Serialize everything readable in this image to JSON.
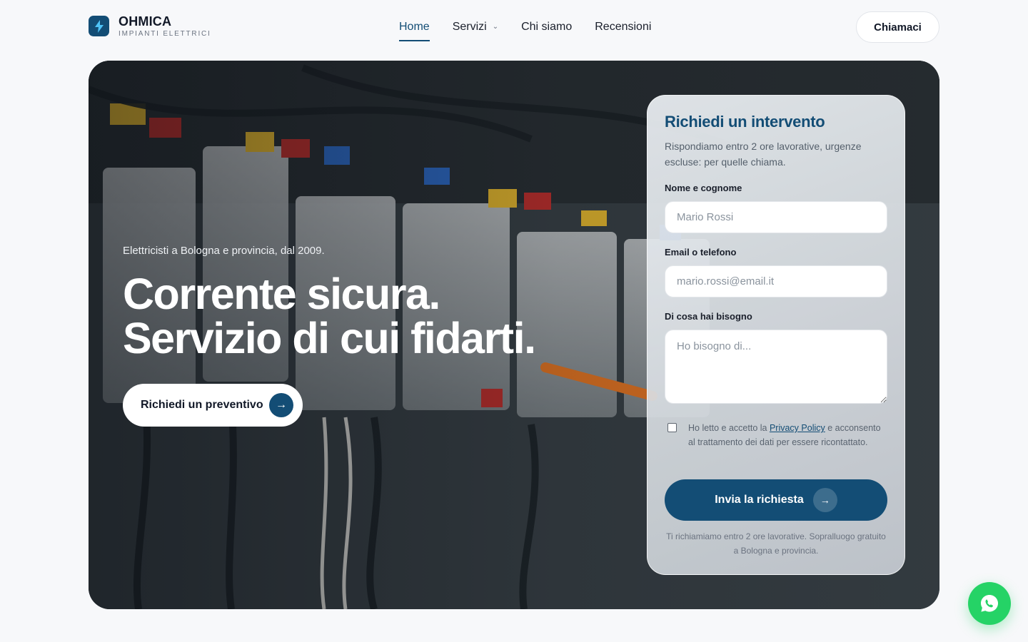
{
  "brand": {
    "name": "OHMICA",
    "tagline": "IMPIANTI ELETTRICI",
    "logo_icon": "lightning-icon",
    "accent_color": "#134d75"
  },
  "nav": {
    "items": [
      {
        "label": "Home",
        "active": true
      },
      {
        "label": "Servizi",
        "has_dropdown": true
      },
      {
        "label": "Chi siamo"
      },
      {
        "label": "Recensioni"
      }
    ],
    "call_button": "Chiamaci"
  },
  "hero": {
    "eyebrow": "Elettricisti a Bologna e provincia, dal 2009.",
    "headline_line1": "Corrente sicura.",
    "headline_line2": "Servizio di cui fidarti.",
    "cta_label": "Richiedi un preventivo",
    "cta_icon": "arrow-right-icon"
  },
  "form": {
    "title": "Richiedi un intervento",
    "subtitle": "Rispondiamo entro 2 ore lavorative, urgenze escluse: per quelle chiama.",
    "name_label": "Nome e cognome",
    "name_placeholder": "Mario Rossi",
    "contact_label": "Email o telefono",
    "contact_placeholder": "mario.rossi@email.it",
    "need_label": "Di cosa hai bisogno",
    "need_placeholder": "Ho bisogno di...",
    "consent_before": "Ho letto e accetto la ",
    "consent_link": "Privacy Policy",
    "consent_after": " e acconsento al trattamento dei dati per essere ricontattato.",
    "consent_checked": false,
    "submit_label": "Invia la richiesta",
    "note": "Ti richiamiamo entro 2 ore lavorative. Sopralluogo gratuito a Bologna e provincia."
  },
  "floating": {
    "whatsapp_icon": "whatsapp-icon",
    "whatsapp_color": "#25d366"
  }
}
